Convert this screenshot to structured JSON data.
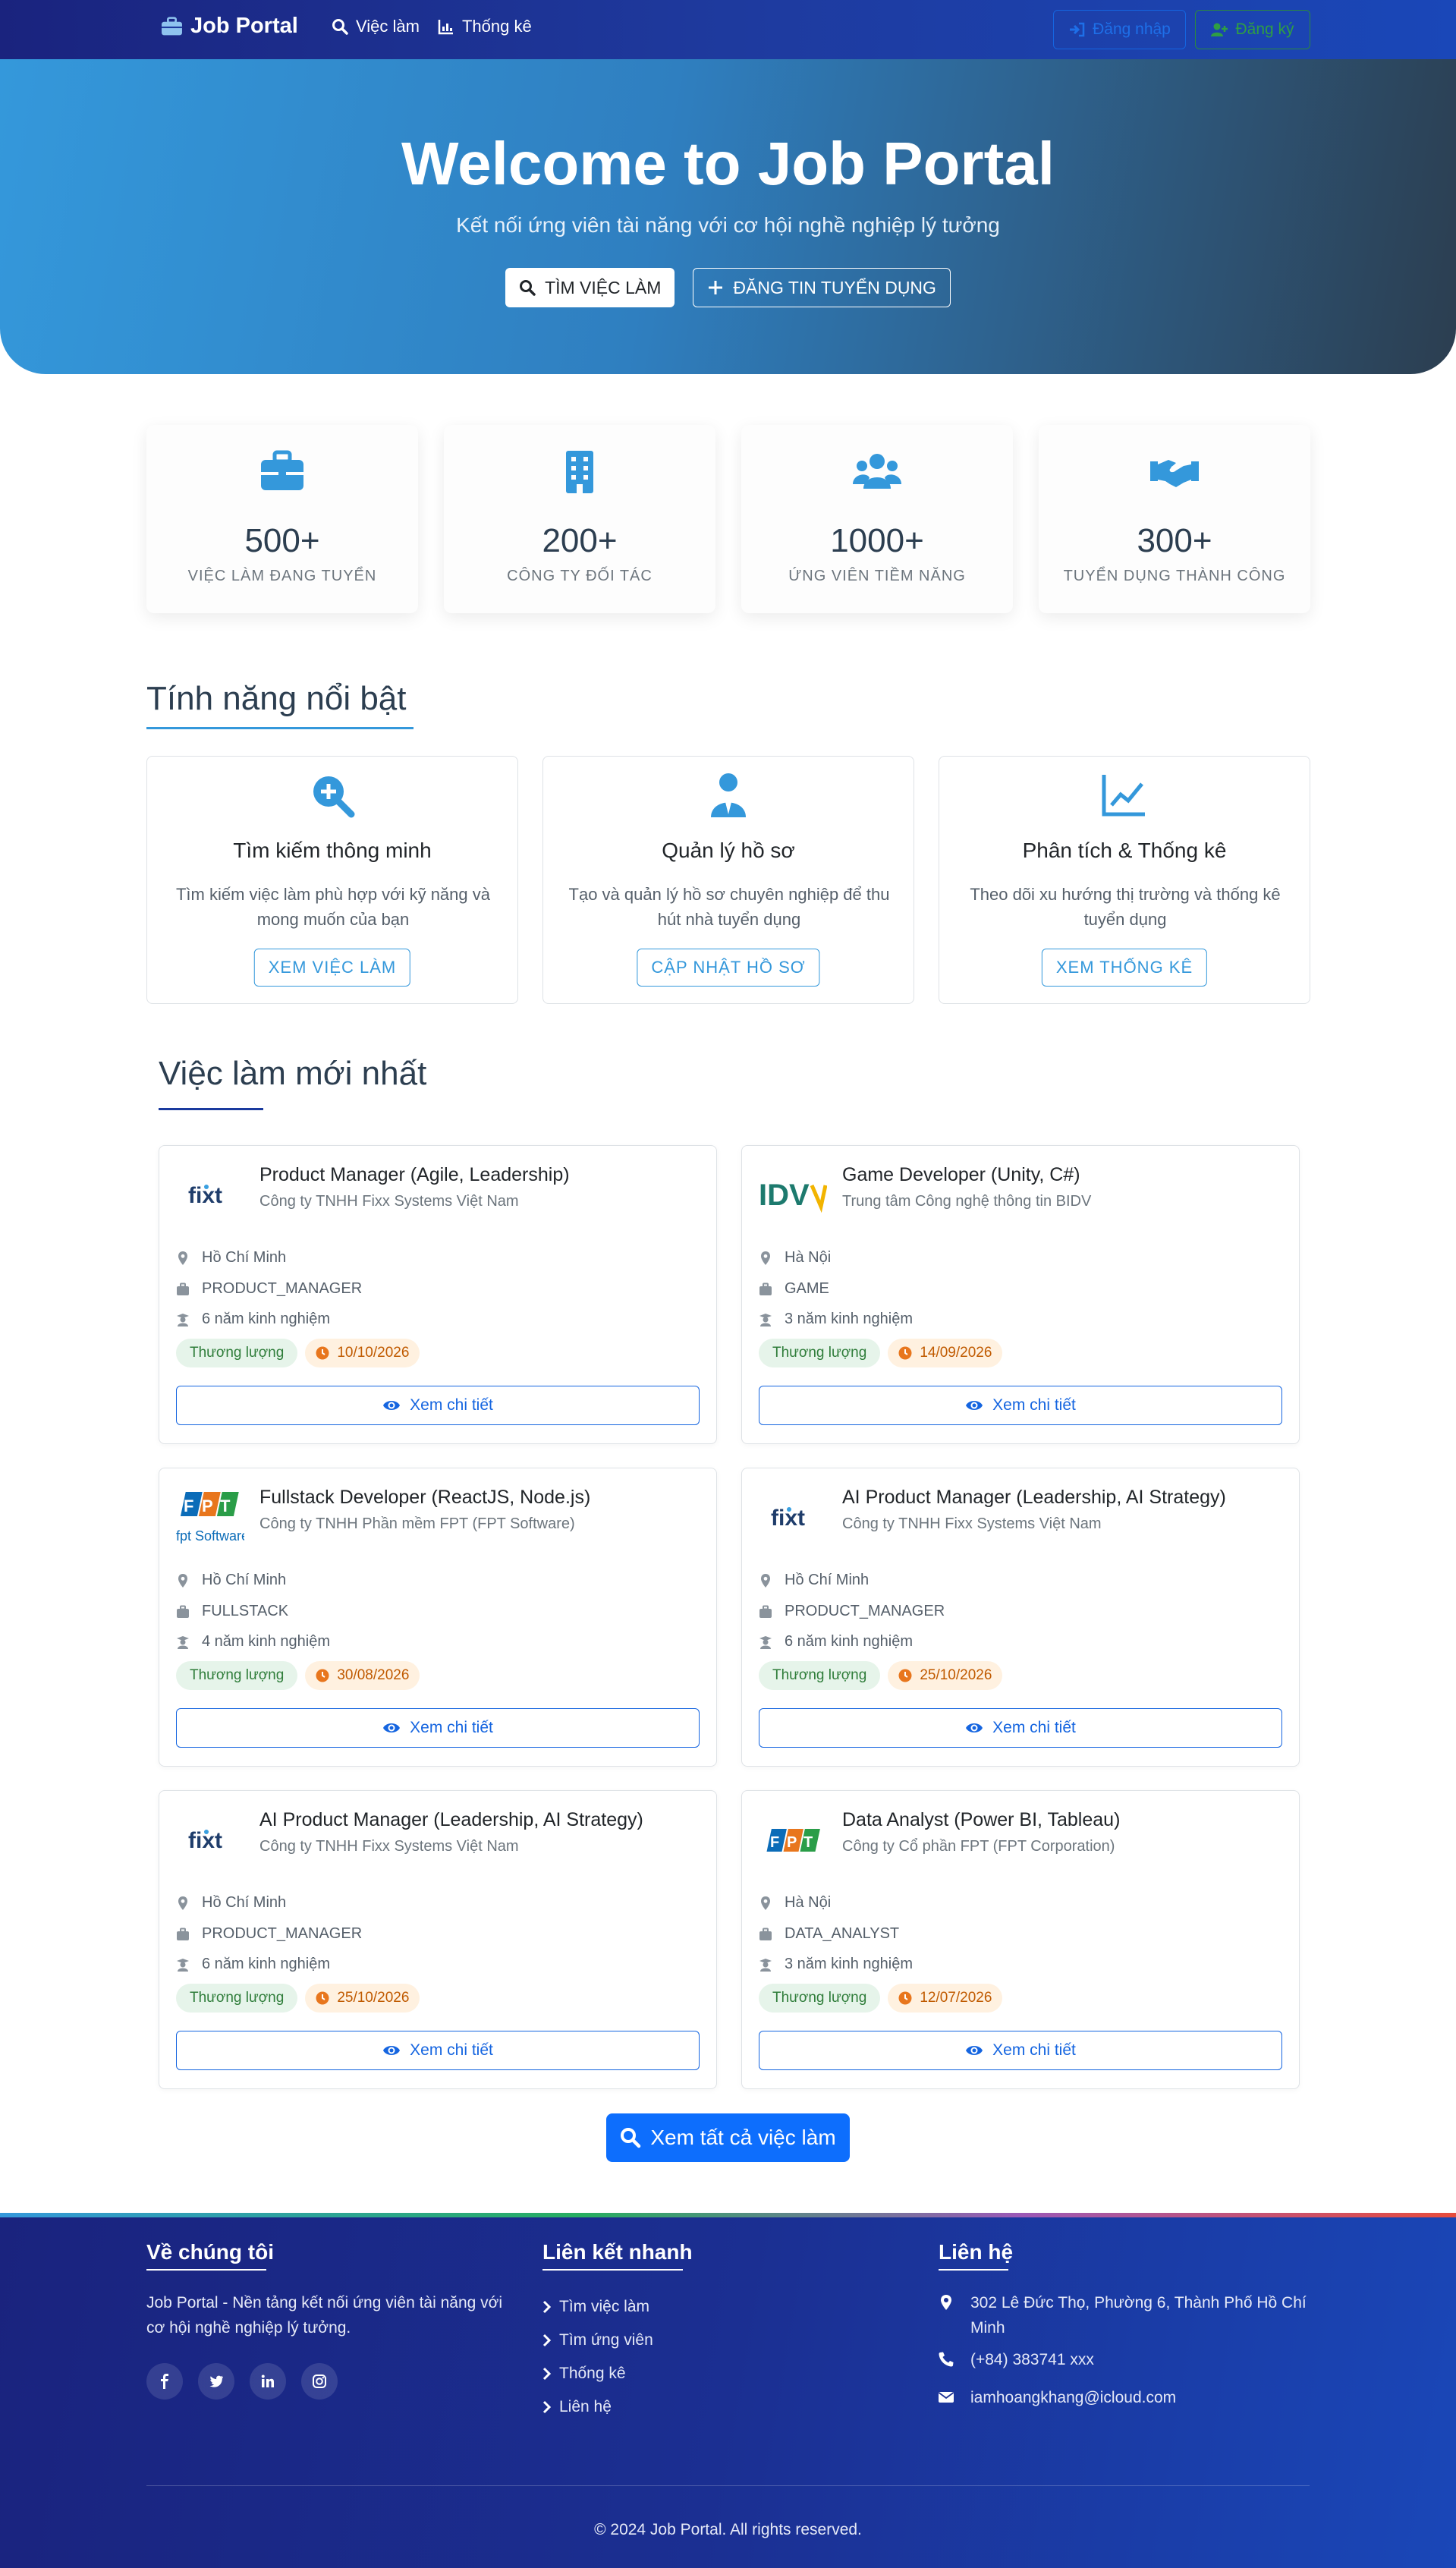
{
  "navbar": {
    "brand": "Job Portal",
    "links": [
      "Việc làm",
      "Thống kê"
    ],
    "login": "Đăng nhập",
    "register": "Đăng ký"
  },
  "hero": {
    "title": "Welcome to Job Portal",
    "subtitle": "Kết nối ứng viên tài năng với cơ hội nghề nghiệp lý tưởng",
    "find_button": "Tìm việc làm",
    "post_button": "Đăng tin tuyển dụng"
  },
  "stats": [
    {
      "value": "500+",
      "label": "Việc làm đang tuyển",
      "icon": "briefcase-icon"
    },
    {
      "value": "200+",
      "label": "Công ty đối tác",
      "icon": "building-icon"
    },
    {
      "value": "1000+",
      "label": "Ứng viên tiềm năng",
      "icon": "users-icon"
    },
    {
      "value": "300+",
      "label": "Tuyển dụng thành công",
      "icon": "handshake-icon"
    }
  ],
  "features": {
    "heading": "Tính năng nổi bật",
    "items": [
      {
        "title": "Tìm kiếm thông minh",
        "desc": "Tìm kiếm việc làm phù hợp với kỹ năng và mong muốn của bạn",
        "button": "Xem việc làm",
        "icon": "search-plus-icon"
      },
      {
        "title": "Quản lý hồ sơ",
        "desc": "Tạo và quản lý hồ sơ chuyên nghiệp để thu hút nhà tuyển dụng",
        "button": "Cập nhật hồ sơ",
        "icon": "user-tie-icon"
      },
      {
        "title": "Phân tích & Thống kê",
        "desc": "Theo dõi xu hướng thị trường và thống kê tuyển dụng",
        "button": "Xem thống kê",
        "icon": "chart-line-icon"
      }
    ]
  },
  "jobs": {
    "heading": "Việc làm mới nhất",
    "view_label": "Xem chi tiết",
    "items": [
      {
        "title": "Product Manager (Agile, Leadership)",
        "company": "Công ty TNHH Fixx Systems Việt Nam",
        "location": "Hồ Chí Minh",
        "category": "PRODUCT_MANAGER",
        "experience": "6 năm kinh nghiệm",
        "salary": "Thương lượng",
        "deadline": "10/10/2026",
        "logo": "fixt"
      },
      {
        "title": "Game Developer (Unity, C#)",
        "company": "Trung tâm Công nghệ thông tin BIDV",
        "location": "Hà Nội",
        "category": "GAME",
        "experience": "3 năm kinh nghiệm",
        "salary": "Thương lượng",
        "deadline": "14/09/2026",
        "logo": "IDV"
      },
      {
        "title": "Fullstack Developer (ReactJS, Node.js)",
        "company": "Công ty TNHH Phần mềm FPT (FPT Software)",
        "location": "Hồ Chí Minh",
        "category": "FULLSTACK",
        "experience": "4 năm kinh nghiệm",
        "salary": "Thương lượng",
        "deadline": "30/08/2026",
        "logo": "FPT Software"
      },
      {
        "title": "AI Product Manager (Leadership, AI Strategy)",
        "company": "Công ty TNHH Fixx Systems Việt Nam",
        "location": "Hồ Chí Minh",
        "category": "PRODUCT_MANAGER",
        "experience": "6 năm kinh nghiệm",
        "salary": "Thương lượng",
        "deadline": "25/10/2026",
        "logo": "fixt"
      },
      {
        "title": "AI Product Manager (Leadership, AI Strategy)",
        "company": "Công ty TNHH Fixx Systems Việt Nam",
        "location": "Hồ Chí Minh",
        "category": "PRODUCT_MANAGER",
        "experience": "6 năm kinh nghiệm",
        "salary": "Thương lượng",
        "deadline": "25/10/2026",
        "logo": "fixt"
      },
      {
        "title": "Data Analyst (Power BI, Tableau)",
        "company": "Công ty Cổ phần FPT (FPT Corporation)",
        "location": "Hà Nội",
        "category": "DATA_ANALYST",
        "experience": "3 năm kinh nghiệm",
        "salary": "Thương lượng",
        "deadline": "12/07/2026",
        "logo": "FPT"
      }
    ],
    "view_all": "Xem tất cả việc làm"
  },
  "footer": {
    "about_heading": "Về chúng tôi",
    "about_text": "Job Portal - Nền tảng kết nối ứng viên tài năng với cơ hội nghề nghiệp lý tưởng.",
    "social": [
      "facebook-icon",
      "twitter-icon",
      "linkedin-icon",
      "instagram-icon"
    ],
    "links_heading": "Liên kết nhanh",
    "links": [
      "Tìm việc làm",
      "Tìm ứng viên",
      "Thống kê",
      "Liên hệ"
    ],
    "contact_heading": "Liên hệ",
    "address": "302 Lê Đức Thọ, Phường 6, Thành Phố Hồ Chí Minh",
    "phone": "(+84) 383741 xxx",
    "email": "iamhoangkhang@icloud.com",
    "copyright": "© 2024 Job Portal. All rights reserved."
  },
  "colors": {
    "primary": "#3498db",
    "nav_bg": "#1a237e",
    "button_blue": "#0d6efd",
    "salary_green": "#2f7d3a",
    "deadline_orange": "#c05a00"
  }
}
